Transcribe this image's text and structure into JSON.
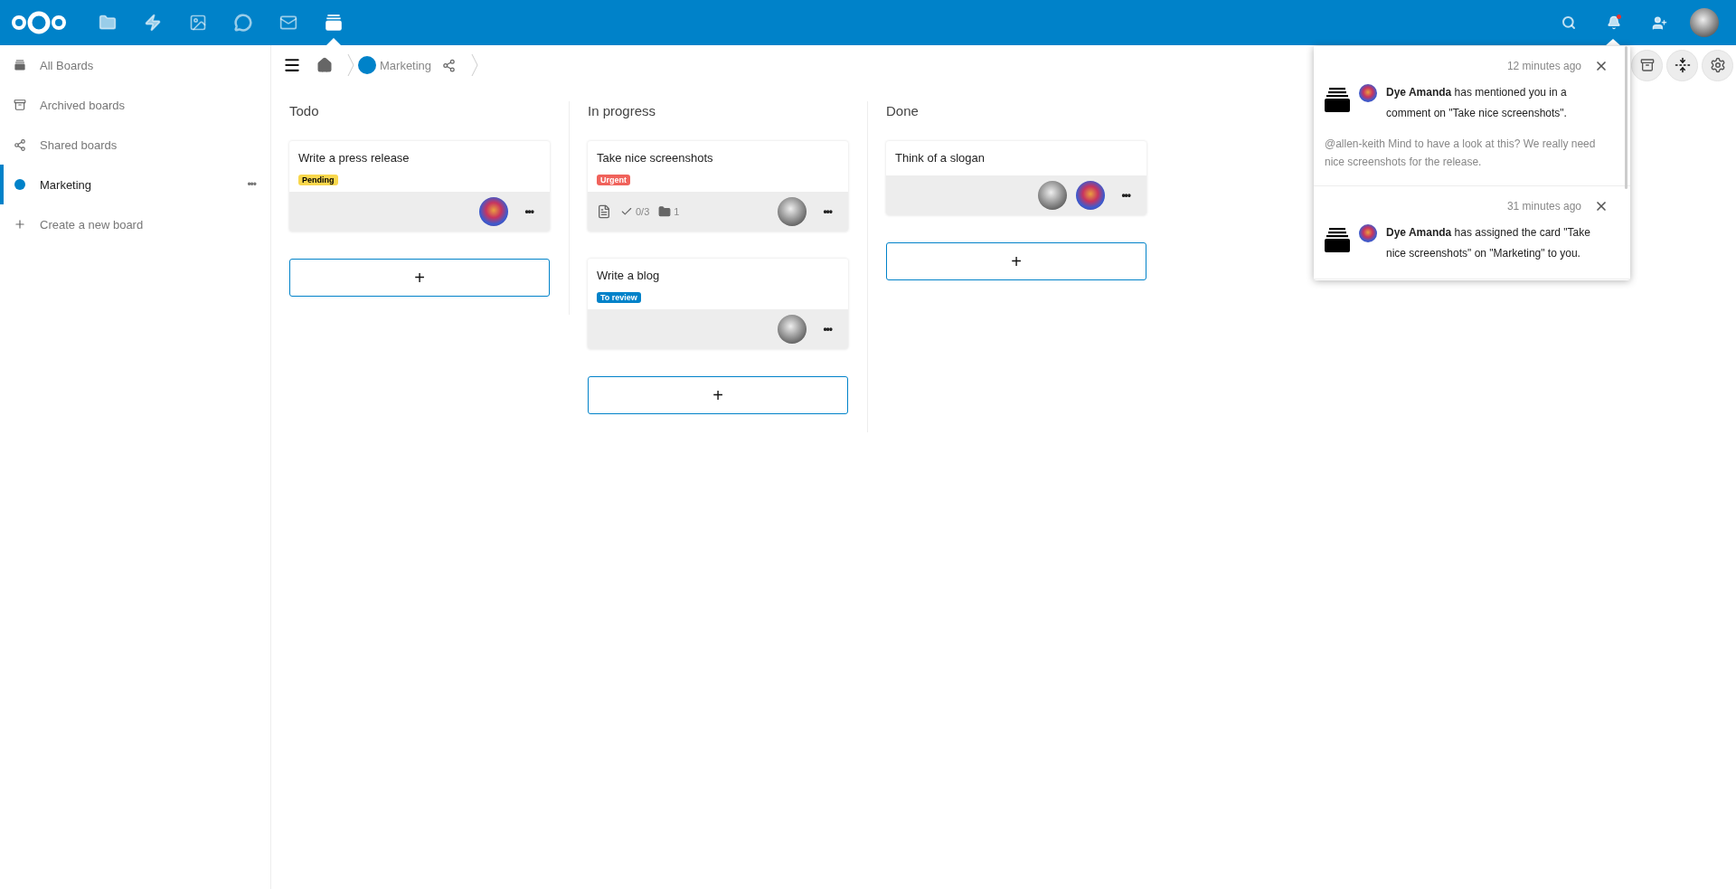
{
  "header": {
    "apps": [
      {
        "kind": "files",
        "selected": false
      },
      {
        "kind": "activity",
        "selected": false
      },
      {
        "kind": "photos",
        "selected": false
      },
      {
        "kind": "talk",
        "selected": false
      },
      {
        "kind": "mail",
        "selected": false
      },
      {
        "kind": "deck",
        "selected": true
      }
    ],
    "notifications_unread": true
  },
  "sidebar": {
    "items": [
      {
        "kind": "all",
        "label": "All Boards",
        "selected": false
      },
      {
        "kind": "archived",
        "label": "Archived boards",
        "selected": false
      },
      {
        "kind": "shared",
        "label": "Shared boards",
        "selected": false
      },
      {
        "kind": "board",
        "label": "Marketing",
        "selected": true,
        "color": "#0082c9",
        "menu": "•••"
      },
      {
        "kind": "create",
        "label": "Create a new board",
        "selected": false
      }
    ]
  },
  "breadcrumb": {
    "board": "Marketing",
    "color": "#0082c9"
  },
  "columns": [
    {
      "title": "Todo",
      "add": "+",
      "cards": [
        {
          "title": "Write a press release",
          "label": {
            "text": "Pending",
            "color": "#f9d74c"
          },
          "description": false,
          "assignees": [
            {
              "kind": "colorful"
            }
          ],
          "menu": "•••"
        }
      ]
    },
    {
      "title": "In progress",
      "add": "+",
      "cards": [
        {
          "title": "Take nice screenshots",
          "label": {
            "text": "Urgent",
            "color": "#f0625b"
          },
          "description": true,
          "checklist": "0/3",
          "attachments": "1",
          "assignees": [
            {
              "kind": "mono"
            }
          ],
          "menu": "•••"
        },
        {
          "title": "Write a blog",
          "label": {
            "text": "To review",
            "color": "#0082c9"
          },
          "description": false,
          "assignees": [
            {
              "kind": "mono"
            }
          ],
          "menu": "•••"
        }
      ]
    },
    {
      "title": "Done",
      "add": "+",
      "cards": [
        {
          "title": "Think of a slogan",
          "description": false,
          "assignees": [
            {
              "kind": "mono"
            },
            {
              "kind": "colorful"
            }
          ],
          "menu": "•••"
        }
      ]
    }
  ],
  "notifications": [
    {
      "time": "12 minutes ago",
      "message": "**Dye Amanda** has mentioned you in a comment on \"Take nice screenshots\".",
      "comment": "@allen-keith Mind to have a look at this? We really need nice screenshots for the release."
    },
    {
      "time": "31 minutes ago",
      "message": "**Dye Amanda** has assigned the card \"Take nice screenshots\" on \"Marketing\" to you."
    }
  ]
}
